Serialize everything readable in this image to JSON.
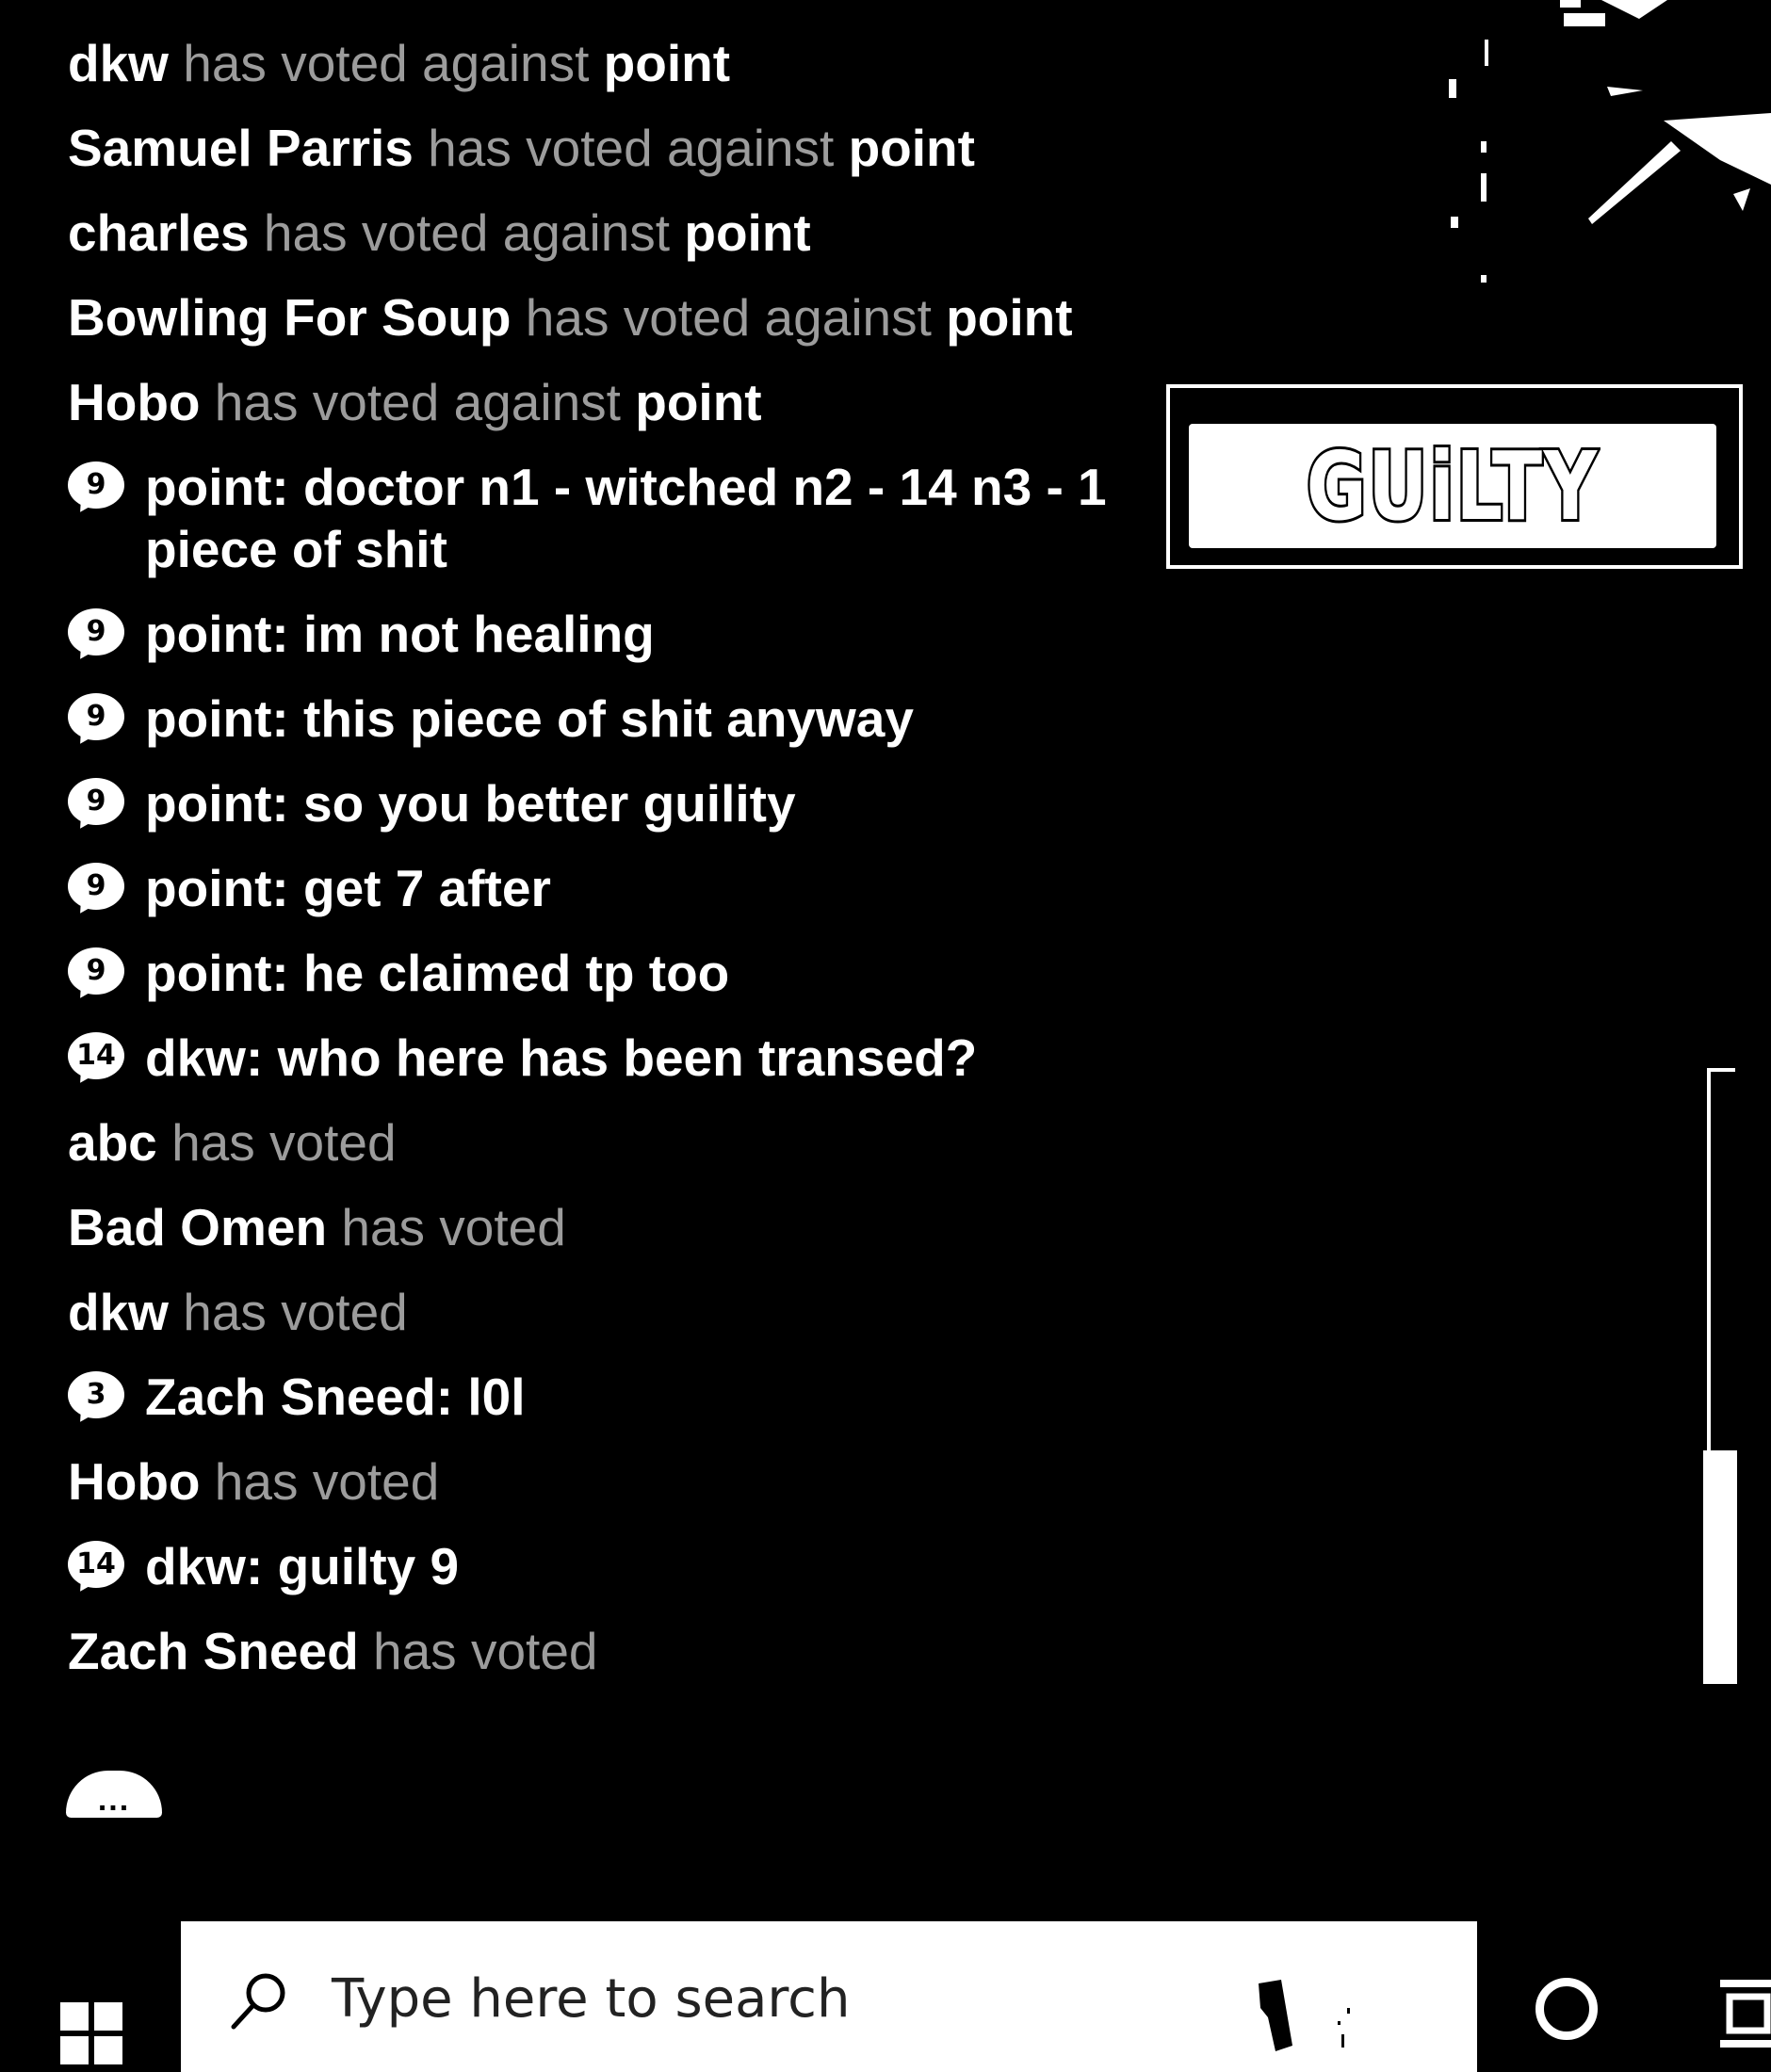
{
  "chat": {
    "entries": [
      {
        "kind": "vote",
        "name": "dkw",
        "verb": "has voted against",
        "target": "point"
      },
      {
        "kind": "vote",
        "name": "Samuel Parris",
        "verb": "has voted against",
        "target": "point"
      },
      {
        "kind": "vote",
        "name": "charles",
        "verb": "has voted against",
        "target": "point"
      },
      {
        "kind": "vote",
        "name": "Bowling For Soup",
        "verb": "has voted against",
        "target": "point"
      },
      {
        "kind": "vote",
        "name": "Hobo",
        "verb": "has voted against",
        "target": "point"
      },
      {
        "kind": "msg",
        "badge": "9",
        "author": "point",
        "text": "doctor n1 - witched n2 - 14 n3 - 1 piece of shit"
      },
      {
        "kind": "msg",
        "badge": "9",
        "author": "point",
        "text": "im not healing"
      },
      {
        "kind": "msg",
        "badge": "9",
        "author": "point",
        "text": "this piece of shit anyway"
      },
      {
        "kind": "msg",
        "badge": "9",
        "author": "point",
        "text": "so you better guility"
      },
      {
        "kind": "msg",
        "badge": "9",
        "author": "point",
        "text": "get 7 after"
      },
      {
        "kind": "msg",
        "badge": "9",
        "author": "point",
        "text": "he claimed tp too"
      },
      {
        "kind": "msg",
        "badge": "14",
        "author": "dkw",
        "text": "who here has been transed?"
      },
      {
        "kind": "vote",
        "name": "abc",
        "verb": "has voted",
        "target": ""
      },
      {
        "kind": "vote",
        "name": "Bad Omen",
        "verb": "has voted",
        "target": ""
      },
      {
        "kind": "vote",
        "name": "dkw",
        "verb": "has voted",
        "target": ""
      },
      {
        "kind": "msg",
        "badge": "3",
        "author": "Zach Sneed",
        "text": "l0l"
      },
      {
        "kind": "vote",
        "name": "Hobo",
        "verb": "has voted",
        "target": ""
      },
      {
        "kind": "msg",
        "badge": "14",
        "author": "dkw",
        "text": "guilty 9"
      },
      {
        "kind": "vote",
        "name": "Zach Sneed",
        "verb": "has voted",
        "target": ""
      }
    ],
    "typing_indicator": "...",
    "typing_icon": "typing-bubble-icon"
  },
  "verdict": {
    "label": "GUiLTY"
  },
  "taskbar": {
    "start_icon": "windows-logo-icon",
    "search_placeholder": "Type here to search",
    "search_icon": "search-icon",
    "mic_icon": "microphone-icon",
    "cortana_icon": "cortana-circle-icon",
    "taskview_icon": "task-view-icon"
  },
  "colors": {
    "background": "#000000",
    "foreground": "#ffffff"
  }
}
